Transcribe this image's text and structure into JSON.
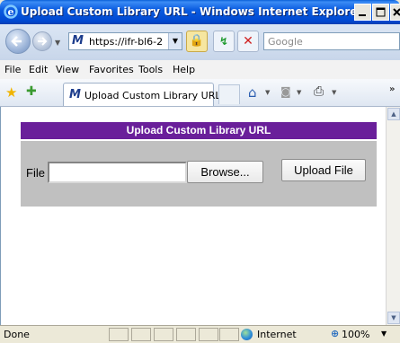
{
  "window": {
    "title": "Upload Custom Library URL - Windows Internet Explorer",
    "min_glyph": "_",
    "max_glyph": "□",
    "close_glyph": "×"
  },
  "navbar": {
    "address": "https://ifr-bl6-2",
    "address_logo": "M",
    "search_placeholder": "Google",
    "refresh_glyph": "↯",
    "stop_glyph": "✕",
    "lock_glyph": "🔒"
  },
  "menu": {
    "items": [
      "File",
      "Edit",
      "View",
      "Favorites",
      "Tools",
      "Help"
    ]
  },
  "tabs": {
    "active_label": "Upload Custom Library URL",
    "logo": "M",
    "more": "»"
  },
  "page": {
    "header": "Upload Custom Library URL",
    "file_label": "File",
    "file_value": "",
    "browse_label": "Browse...",
    "upload_label": "Upload File"
  },
  "status": {
    "text": "Done",
    "zone": "Internet",
    "zoom": "100%"
  },
  "icons": {
    "favorites": "star-icon",
    "add_favorite": "add-favorite-icon",
    "home": "home-icon",
    "feeds": "feeds-icon",
    "print": "print-icon",
    "zone": "globe-icon"
  }
}
